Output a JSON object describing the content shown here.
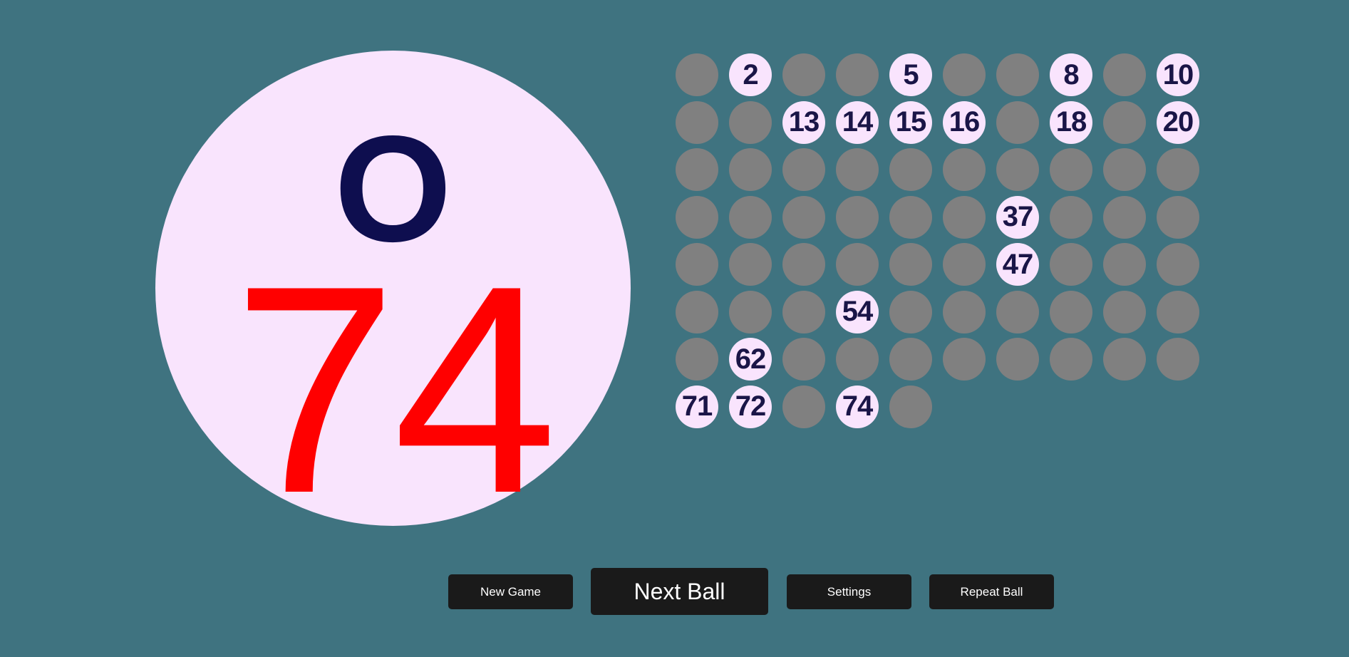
{
  "current_ball": {
    "letter": "O",
    "number": "74"
  },
  "board": {
    "total_numbers": 75,
    "columns": 10,
    "called_numbers": [
      2,
      5,
      8,
      10,
      13,
      14,
      15,
      16,
      18,
      20,
      37,
      47,
      54,
      62,
      71,
      72,
      74
    ]
  },
  "colors": {
    "background": "#3f7380",
    "ball_fill": "#f9e4fd",
    "letter_color": "#0e0e4f",
    "number_color": "#ff0000",
    "uncalled_cell": "#808080",
    "called_cell_text": "#1a1547",
    "button_bg": "#1a1a1a",
    "button_text": "#ffffff"
  },
  "buttons": {
    "new_game": "New Game",
    "next_ball": "Next Ball",
    "settings": "Settings",
    "repeat_ball": "Repeat Ball"
  }
}
